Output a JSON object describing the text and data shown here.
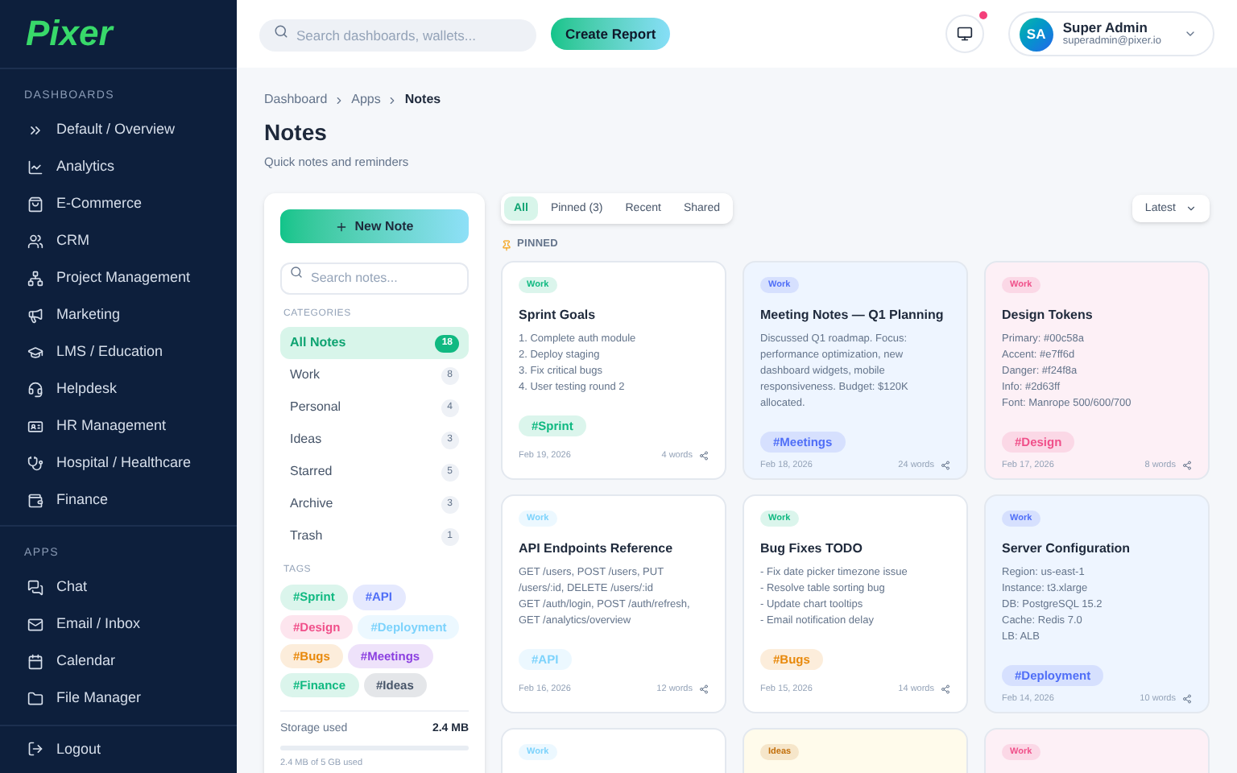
{
  "sidebar": {
    "logo": "Pixer",
    "sections": [
      {
        "title": "DASHBOARDS",
        "items": [
          {
            "label": "Default / Overview"
          },
          {
            "label": "Analytics"
          },
          {
            "label": "E-Commerce"
          },
          {
            "label": "CRM"
          },
          {
            "label": "Project Management"
          },
          {
            "label": "Marketing"
          },
          {
            "label": "LMS / Education"
          },
          {
            "label": "Helpdesk"
          },
          {
            "label": "HR Management"
          },
          {
            "label": "Hospital / Healthcare"
          },
          {
            "label": "Finance"
          }
        ]
      },
      {
        "title": "APPS",
        "items": [
          {
            "label": "Chat"
          },
          {
            "label": "Email / Inbox"
          },
          {
            "label": "Calendar"
          },
          {
            "label": "File Manager"
          }
        ]
      }
    ],
    "logout": "Logout"
  },
  "header": {
    "search_placeholder": "Search dashboards, wallets...",
    "create_button": "Create Report",
    "user": {
      "initials": "SA",
      "name": "Super Admin",
      "email": "superadmin@pixer.io"
    }
  },
  "breadcrumb": [
    "Dashboard",
    "Apps",
    "Notes"
  ],
  "page_title": "Notes",
  "page_subtitle": "Quick notes and reminders",
  "notes_panel": {
    "new_button": "New Note",
    "search_placeholder": "Search notes...",
    "categories_title": "CATEGORIES",
    "categories": [
      {
        "label": "All Notes",
        "count": "18",
        "selected": true
      },
      {
        "label": "Work",
        "count": "8",
        "selected": false
      },
      {
        "label": "Personal",
        "count": "4",
        "selected": false
      },
      {
        "label": "Ideas",
        "count": "3",
        "selected": false
      },
      {
        "label": "Starred",
        "count": "5",
        "selected": false
      },
      {
        "label": "Archive",
        "count": "3",
        "selected": false
      },
      {
        "label": "Trash",
        "count": "1",
        "selected": false
      }
    ],
    "tags_title": "TAGS",
    "tags": [
      {
        "label": "#Sprint",
        "color": "#10b981"
      },
      {
        "label": "#API",
        "color": "#4f6ef7"
      },
      {
        "label": "#Design",
        "color": "#f0508a"
      },
      {
        "label": "#Deployment",
        "color": "#7dd3fc"
      },
      {
        "label": "#Bugs",
        "color": "#e8890c"
      },
      {
        "label": "#Meetings",
        "color": "#8b3fe0"
      },
      {
        "label": "#Finance",
        "color": "#10b981"
      },
      {
        "label": "#Ideas",
        "color": "#475569"
      }
    ],
    "storage": {
      "label": "Storage used",
      "value": "2.4 MB",
      "level": 0.0005,
      "note": "2.4 MB of 5 GB used"
    }
  },
  "filter_tabs": [
    {
      "label": "All",
      "selected": true
    },
    {
      "label": "Pinned (3)",
      "selected": false
    },
    {
      "label": "Recent",
      "selected": false
    },
    {
      "label": "Shared",
      "selected": false
    }
  ],
  "sort_select": "Latest",
  "pinned_label": "PINNED",
  "notes": [
    {
      "category": {
        "label": "Work",
        "color": "#10b981"
      },
      "color": "#ffffff",
      "title": "Sprint Goals",
      "lines": [
        "1. Complete auth module",
        "2. Deploy staging",
        "3. Fix critical bugs",
        "4. User testing round 2"
      ],
      "tag": {
        "label": "#Sprint",
        "color": "#10b981"
      },
      "date": "Feb 19, 2026",
      "words": "4 words"
    },
    {
      "category": {
        "label": "Work",
        "color": "#4f6ef7"
      },
      "color": "#eef5ff",
      "title": "Meeting Notes — Q1 Planning",
      "lines": [
        "Discussed Q1 roadmap. Focus: performance optimization, new dashboard widgets, mobile responsiveness. Budget: $120K allocated."
      ],
      "tag": {
        "label": "#Meetings",
        "color": "#4f6ef7"
      },
      "date": "Feb 18, 2026",
      "words": "24 words"
    },
    {
      "category": {
        "label": "Work",
        "color": "#f0508a"
      },
      "color": "#fdf0f6",
      "title": "Design Tokens",
      "lines": [
        "Primary: #00c58a",
        "Accent: #e7ff6d",
        "Danger: #f24f8a",
        "Info: #2d63ff",
        "Font: Manrope 500/600/700"
      ],
      "tag": {
        "label": "#Design",
        "color": "#f0508a"
      },
      "date": "Feb 17, 2026",
      "words": "8 words"
    },
    {
      "category": {
        "label": "Work",
        "color": "#7dd3fc"
      },
      "color": "#ffffff",
      "title": "API Endpoints Reference",
      "lines": [
        "GET /users, POST /users, PUT /users/:id, DELETE /users/:id",
        "GET /auth/login, POST /auth/refresh, GET /analytics/overview"
      ],
      "tag": {
        "label": "#API",
        "color": "#7dd3fc"
      },
      "date": "Feb 16, 2026",
      "words": "12 words"
    },
    {
      "category": {
        "label": "Work",
        "color": "#10b981"
      },
      "color": "#ffffff",
      "title": "Bug Fixes TODO",
      "lines": [
        "- Fix date picker timezone issue",
        "- Resolve table sorting bug",
        "- Update chart tooltips",
        "- Email notification delay"
      ],
      "tag": {
        "label": "#Bugs",
        "color": "#e8890c"
      },
      "date": "Feb 15, 2026",
      "words": "14 words"
    },
    {
      "category": {
        "label": "Work",
        "color": "#4f6ef7"
      },
      "color": "#eef5ff",
      "title": "Server Configuration",
      "lines": [
        "Region: us-east-1",
        "Instance: t3.xlarge",
        "DB: PostgreSQL 15.2",
        "Cache: Redis 7.0",
        "LB: ALB"
      ],
      "tag": {
        "label": "#Deployment",
        "color": "#4f6ef7"
      },
      "date": "Feb 14, 2026",
      "words": "10 words"
    },
    {
      "category": {
        "label": "Work",
        "color": "#7dd3fc"
      },
      "color": "#ffffff"
    },
    {
      "category": {
        "label": "Ideas",
        "color": "#c2700c"
      },
      "color": "#fffbeb"
    },
    {
      "category": {
        "label": "Work",
        "color": "#f0508a"
      },
      "color": "#fdf0f6"
    }
  ]
}
